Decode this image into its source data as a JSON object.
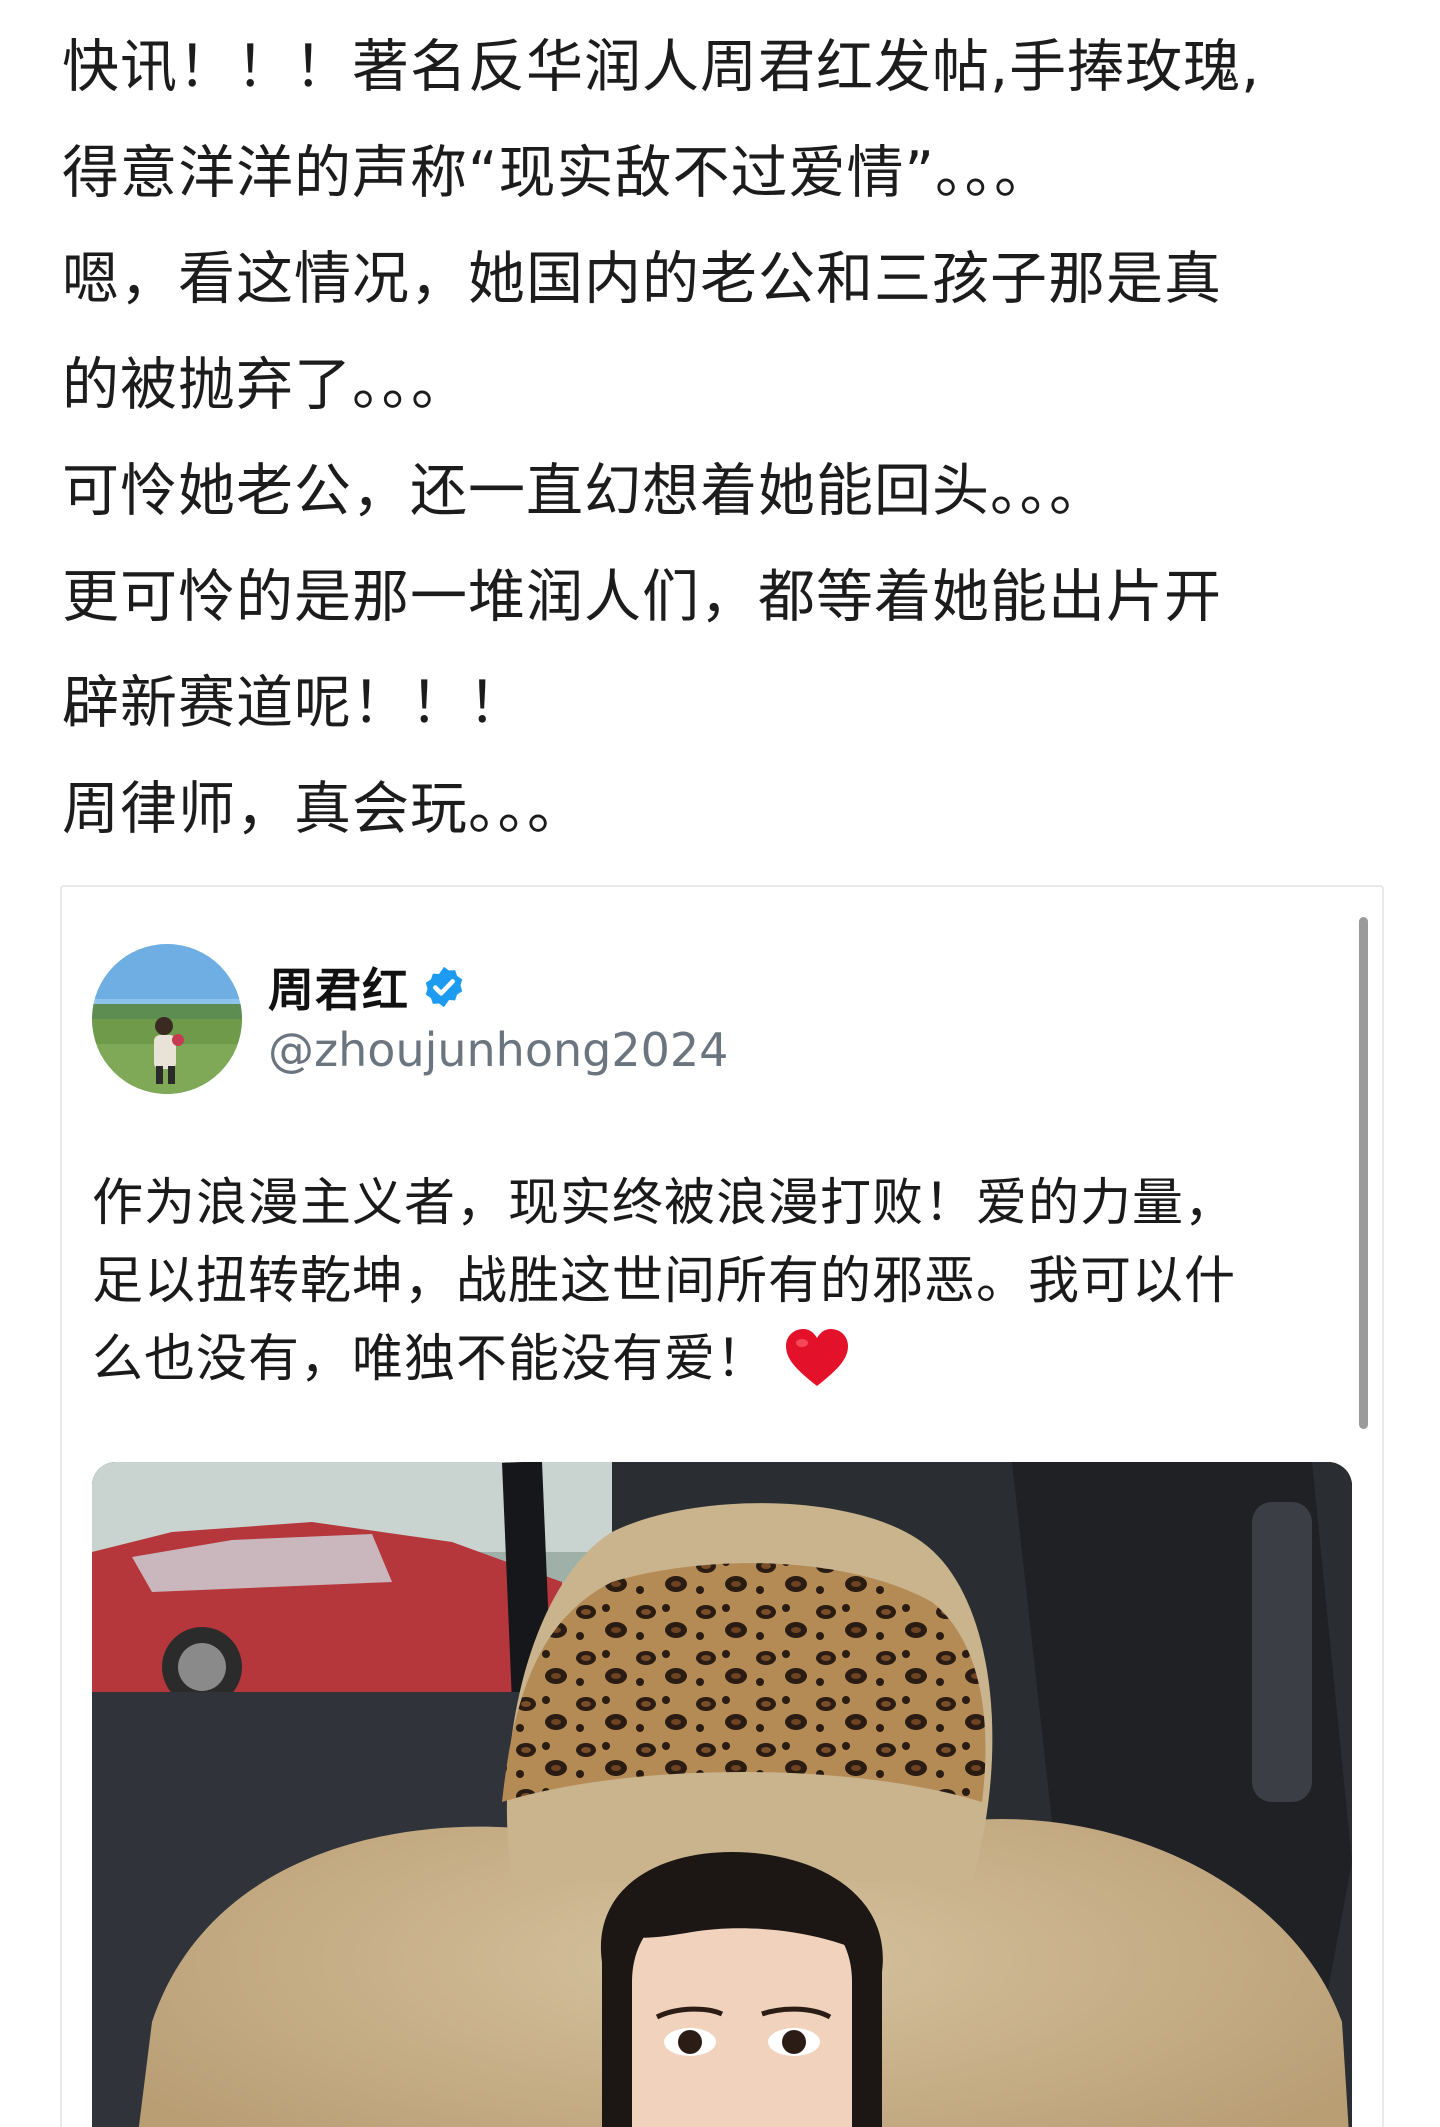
{
  "post": {
    "lines": [
      "快讯！！！著名反华润人周君红发帖,手捧玫瑰,",
      "得意洋洋的声称“现实敌不过爱情”。。。",
      "嗯，看这情况，她国内的老公和三孩子那是真",
      "的被抛弃了。。。",
      "可怜她老公，还一直幻想着她能回头。。。",
      "更可怜的是那一堆润人们，都等着她能出片开",
      "辟新赛道呢！！！",
      "周律师，真会玩。。。"
    ]
  },
  "embed": {
    "author_name": "周君红",
    "author_handle": "@zhoujunhong2024",
    "verified_icon": "verified-badge-icon",
    "tweet_lines": [
      "作为浪漫主义者，现实终被浪漫打败！爱的力量，",
      "足以扭转乾坤，战胜这世间所有的邪恶。我可以什",
      "么也没有，唯独不能没有爱！"
    ],
    "emoji": "red-heart-icon",
    "colors": {
      "verified": "#1d9bf0",
      "handle": "#6b7580",
      "heart": "#e3122a"
    }
  }
}
